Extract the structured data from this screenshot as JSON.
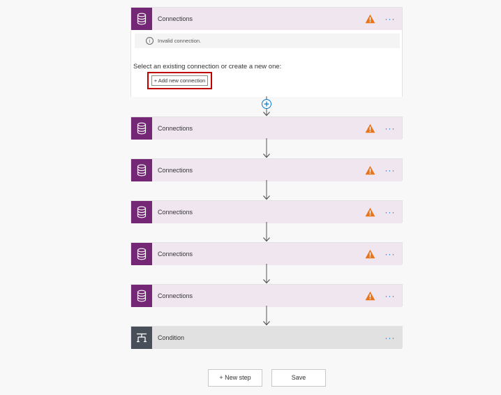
{
  "steps": [
    {
      "title": "Connections",
      "icon": "database-icon",
      "status": "warning",
      "expanded": true
    },
    {
      "title": "Connections",
      "icon": "database-icon",
      "status": "warning"
    },
    {
      "title": "Connections",
      "icon": "database-icon",
      "status": "warning"
    },
    {
      "title": "Connections",
      "icon": "database-icon",
      "status": "warning"
    },
    {
      "title": "Connections",
      "icon": "database-icon",
      "status": "warning"
    },
    {
      "title": "Connections",
      "icon": "database-icon",
      "status": "warning"
    },
    {
      "title": "Condition",
      "icon": "condition-icon"
    }
  ],
  "expanded": {
    "info_text": "Invalid connection.",
    "prompt": "Select an existing connection or create a new one:",
    "add_button_label": "+ Add new connection"
  },
  "footer": {
    "new_step_label": "+ New step",
    "save_label": "Save"
  },
  "colors": {
    "accent_purple": "#742774",
    "header_purple_tint": "#f0e6f0",
    "warning_orange": "#e8751a",
    "link_blue": "#0078d4",
    "highlight_red": "#c00000",
    "condition_gray": "#484f58"
  }
}
